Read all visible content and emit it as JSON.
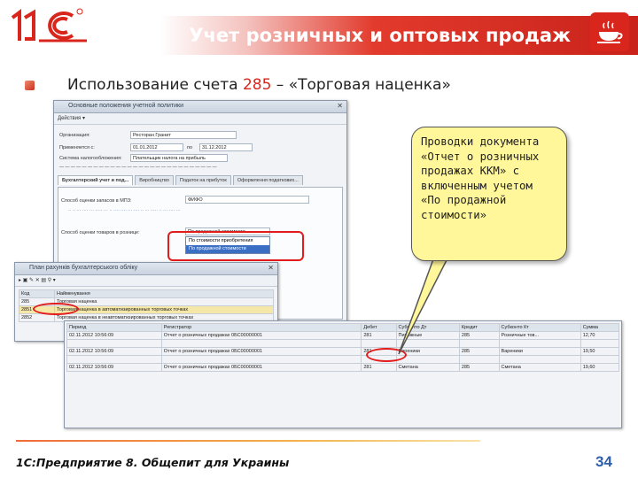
{
  "header": {
    "logo_text": "1С",
    "title": "Учет розничных и оптовых продаж"
  },
  "subtitle": {
    "text_before": "Использование счета ",
    "account_number": "285",
    "text_after": " – «Торговая наценка»"
  },
  "settings_window": {
    "title": "Основные положения учетной политики",
    "toolbar": "Действия ▾",
    "fields": [
      {
        "label": "Организация:",
        "value": "Ресторан Гранит"
      },
      {
        "label": "Применяется с:",
        "value": "01.01.2012",
        "to_label": "по",
        "to_value": "31.12.2012"
      },
      {
        "label": "Система налогообложения:",
        "value": "Плательщик налога на прибыль"
      }
    ],
    "tabs": [
      "Бухгалтерский учет и под...",
      "Виробництво",
      "Податок на прибуток",
      "Оформлення податкових..."
    ],
    "method_label": "Способ оценки запасов в МПЗ:",
    "method_value": "ФИФО",
    "goods_label": "Способ оценки товаров в рознице:",
    "goods_value": "По продажной стоимости",
    "dropdown_options": [
      "По стоимости приобретения",
      "По продажной стоимости"
    ]
  },
  "accounts_window": {
    "title": "План рахунків бухгалтерського обліку",
    "columns": [
      "Код",
      "Найменування"
    ],
    "rows": [
      {
        "code": "285",
        "name": "Торговая наценка"
      },
      {
        "code": "2851",
        "name": "Торговая наценка в автоматизированных торговых точках"
      },
      {
        "code": "2852",
        "name": "Торговая наценка в неавтоматизированных торговых точках"
      }
    ]
  },
  "postings_window": {
    "columns": [
      "Период",
      "Регистратор",
      "Дебет",
      "Субконто Дт",
      "Кредит",
      "Субконто Кт",
      "Сумма"
    ],
    "rows": [
      {
        "period": "02.11.2012 10:56:09",
        "doc": "Отчет о розничных продажах 0БС00000001",
        "dt": "281",
        "sub_dt": "Пирожные",
        "kt": "285",
        "sub_kt": "Розничные тов...",
        "sum": "12,70"
      },
      {
        "period": "02.11.2012 10:56:09",
        "doc": "Отчет о розничных продажах 0БС00000001",
        "dt": "281",
        "sub_dt": "Вареники",
        "kt": "285",
        "sub_kt": "Вареники",
        "sum": "19,50"
      },
      {
        "period": "02.11.2012 10:56:09",
        "doc": "Отчет о розничных продажах 0БС00000001",
        "dt": "281",
        "sub_dt": "Сметана",
        "kt": "285",
        "sub_kt": "Сметана",
        "sum": "19,60"
      }
    ]
  },
  "callout": {
    "text": "Проводки документа «Отчет о розничных продажах ККМ» с включенным учетом «По продажной стоимости»"
  },
  "footer": {
    "text": "1С:Предприятие 8. Общепит для Украины",
    "page": "34"
  },
  "colors": {
    "brand_red": "#d9261c",
    "callout_yellow": "#fff79a",
    "page_blue": "#2f5fa8"
  }
}
